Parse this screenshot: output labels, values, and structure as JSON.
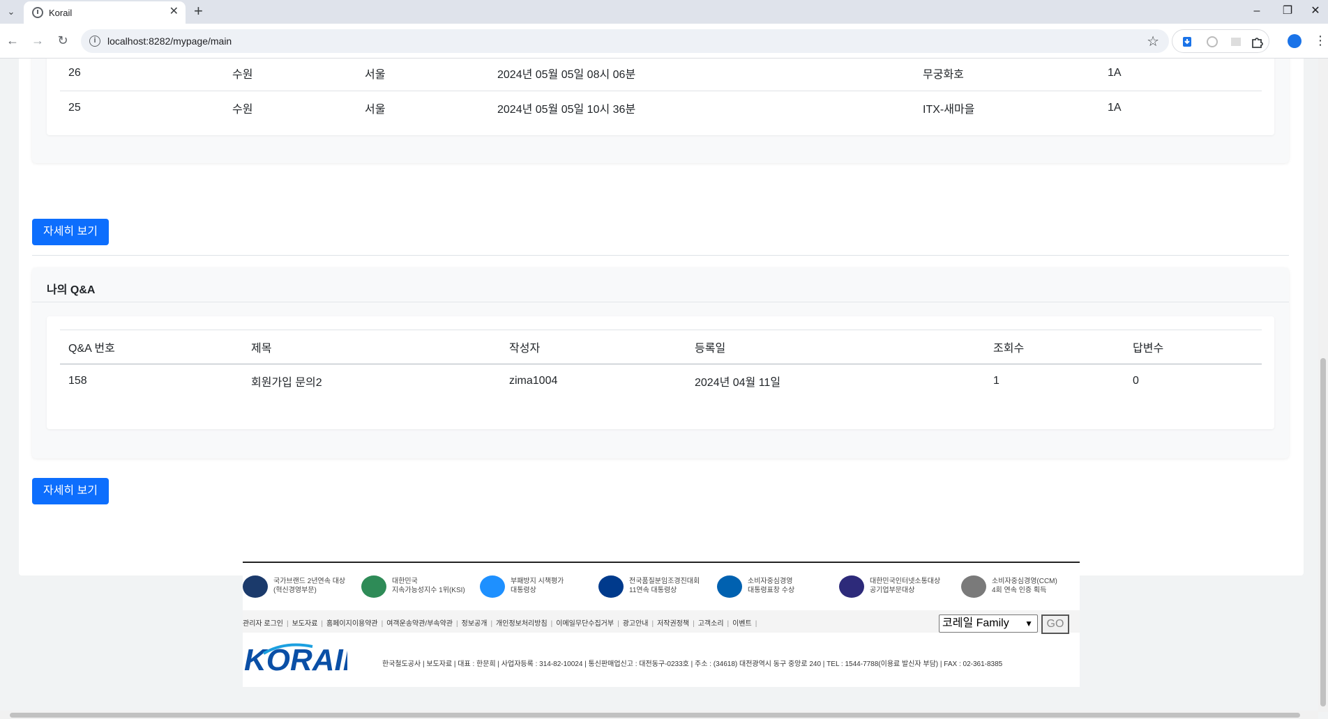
{
  "browser": {
    "tab_title": "Korail",
    "url": "localhost:8282/mypage/main",
    "new_tab_glyph": "+",
    "tab_close_glyph": "✕"
  },
  "reservations": {
    "rows": [
      {
        "no": "26",
        "from": "수원",
        "to": "서울",
        "datetime": "2024년 05월 05일 08시 06분",
        "train": "무궁화호",
        "seat": "1A"
      },
      {
        "no": "25",
        "from": "수원",
        "to": "서울",
        "datetime": "2024년 05월 05일 10시 36분",
        "train": "ITX-새마을",
        "seat": "1A"
      }
    ],
    "detail_button": "자세히 보기"
  },
  "qna": {
    "section_title": "나의 Q&A",
    "headers": [
      "Q&A 번호",
      "제목",
      "작성자",
      "등록일",
      "조회수",
      "답변수"
    ],
    "rows": [
      {
        "no": "158",
        "title": "회원가입 문의2",
        "author": "zima1004",
        "date": "2024년 04월 11일",
        "views": "1",
        "answers": "0"
      }
    ],
    "detail_button": "자세히 보기"
  },
  "footer": {
    "awards": [
      {
        "text": "국가브랜드 2년연속 대상\n(혁신경영부문)",
        "icon": "nba-award-icon",
        "color": "#1b3a6b"
      },
      {
        "text": "대한민국\n지속가능성지수 1위(KSI)",
        "icon": "ksi-award-icon",
        "color": "#2e8b57"
      },
      {
        "text": "부패방지 시책평가\n대통령상",
        "icon": "anti-corruption-award-icon",
        "color": "#1e90ff"
      },
      {
        "text": "전국품질분임조경진대회\n11연속 대통령상",
        "icon": "kpa-award-icon",
        "color": "#003a8c"
      },
      {
        "text": "소비자중심경영\n대통령표창 수상",
        "icon": "fair-trade-award-icon",
        "color": "#0061b0"
      },
      {
        "text": "대한민국인터넷소통대상\n공기업부문대상",
        "icon": "icsi-award-icon",
        "color": "#2d2a7a"
      },
      {
        "text": "소비자중심경영(CCM)\n4회 연속 인증 획득",
        "icon": "ccm-award-icon",
        "color": "#7a7a7a"
      }
    ],
    "links": [
      "관리자 로그인",
      "보도자료",
      "홈페이지이용약관",
      "여객운송약관/부속약관",
      "정보공개",
      "개인정보처리방침",
      "이메일무단수집거부",
      "광고안내",
      "저작권정책",
      "고객소리",
      "이벤트"
    ],
    "family_select": "코레일 Family",
    "go_label": "GO",
    "logo_text": "KORAIL",
    "company_info": "한국철도공사  |  보도자료  |  대표 : 한문희  |  사업자등록 : 314-82-10024  |  통신판매업신고 : 대전동구-0233호  |  주소 : (34618) 대전광역시 동구 중앙로 240  |  TEL : 1544-7788(이용료 발신자 부담)  |  FAX : 02-361-8385"
  }
}
